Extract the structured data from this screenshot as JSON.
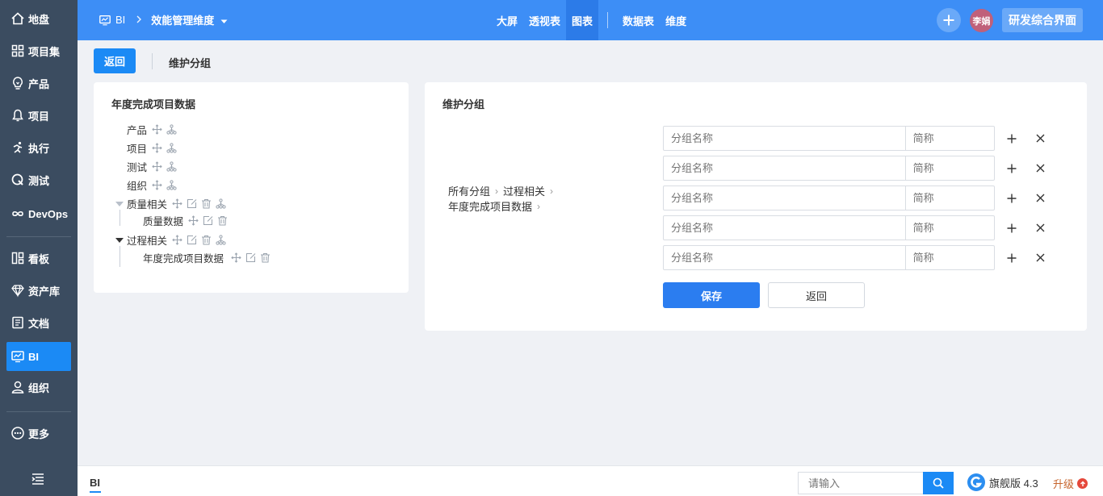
{
  "sidebar": {
    "items": [
      {
        "label": "地盘",
        "icon": "home-icon"
      },
      {
        "label": "项目集",
        "icon": "grid-icon"
      },
      {
        "label": "产品",
        "icon": "bulb-icon"
      },
      {
        "label": "项目",
        "icon": "bell-icon"
      },
      {
        "label": "执行",
        "icon": "run-icon"
      },
      {
        "label": "测试",
        "icon": "test-icon"
      },
      {
        "label": "DevOps",
        "icon": "infinity-icon"
      },
      {
        "label": "看板",
        "icon": "kanban-icon"
      },
      {
        "label": "资产库",
        "icon": "diamond-icon"
      },
      {
        "label": "文档",
        "icon": "document-icon"
      },
      {
        "label": "BI",
        "icon": "monitor-icon"
      },
      {
        "label": "组织",
        "icon": "user-icon"
      },
      {
        "label": "更多",
        "icon": "more-icon"
      }
    ],
    "active": "BI"
  },
  "header": {
    "module": "BI",
    "dimension": "效能管理维度",
    "nav_left": [
      "大屏",
      "透视表",
      "图表"
    ],
    "nav_active": "图表",
    "nav_right": [
      "数据表",
      "维度"
    ],
    "user": "李娟",
    "env_button": "研发综合界面",
    "accent": "#3d8ef6"
  },
  "toolbar": {
    "back_label": "返回",
    "title": "维护分组"
  },
  "tree": {
    "title": "年度完成项目数据",
    "top_items": [
      "产品",
      "项目",
      "测试",
      "组织"
    ],
    "group1": {
      "label": "质量相关",
      "children": [
        "质量数据"
      ]
    },
    "group2": {
      "label": "过程相关",
      "children": [
        "年度完成项目数据"
      ]
    }
  },
  "maintain": {
    "title": "维护分组",
    "path": [
      "所有分组",
      "过程相关",
      "年度完成项目数据"
    ],
    "rows": [
      {
        "name_placeholder": "分组名称",
        "short_placeholder": "简称"
      },
      {
        "name_placeholder": "分组名称",
        "short_placeholder": "简称"
      },
      {
        "name_placeholder": "分组名称",
        "short_placeholder": "简称"
      },
      {
        "name_placeholder": "分组名称",
        "short_placeholder": "简称"
      },
      {
        "name_placeholder": "分组名称",
        "short_placeholder": "简称"
      }
    ],
    "save_label": "保存",
    "cancel_label": "返回"
  },
  "footer": {
    "tab": "BI",
    "search_placeholder": "请输入",
    "edition": "旗舰版 4.3",
    "upgrade": "升级"
  }
}
